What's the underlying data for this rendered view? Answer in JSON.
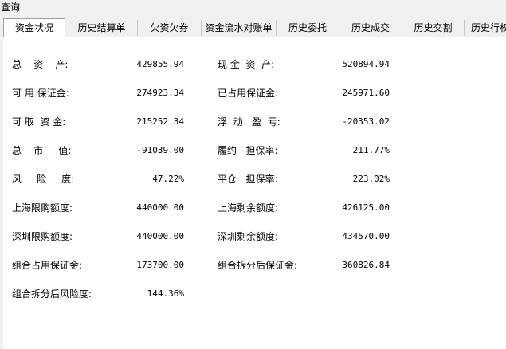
{
  "window": {
    "title": "查询"
  },
  "tabs": [
    {
      "label": "资金状况",
      "active": true
    },
    {
      "label": "历史结算单"
    },
    {
      "label": "欠资欠券"
    },
    {
      "label": "资金流水对账单"
    },
    {
      "label": "历史委托"
    },
    {
      "label": "历史成交"
    },
    {
      "label": "历史交割"
    },
    {
      "label": "历史行权"
    }
  ],
  "fields": {
    "total_assets": {
      "label": "总    资    产:",
      "value": "429855.94"
    },
    "cash_assets": {
      "label": "现 金  资  产:",
      "value": "520894.94"
    },
    "available_margin": {
      "label": "可 用 保证金:",
      "value": "274923.34"
    },
    "used_margin": {
      "label": "已占用保证金:",
      "value": "245971.60"
    },
    "withdrawable": {
      "label": "可 取  资 金:",
      "value": "215252.34"
    },
    "floating_pnl": {
      "label": "浮  动   盈  亏:",
      "value": "-20353.02"
    },
    "market_value": {
      "label": "总    市     值:",
      "value": "-91039.00"
    },
    "performance_ratio": {
      "label": "履约   担保率:",
      "value": "211.77%"
    },
    "risk_level": {
      "label": "风     险     度:",
      "value": "47.22%"
    },
    "closeout_ratio": {
      "label": "平仓   担保率:",
      "value": "223.02%"
    },
    "sh_limit": {
      "label": "上海限购额度:",
      "value": "440000.00"
    },
    "sh_remaining": {
      "label": "上海剩余额度:",
      "value": "426125.00"
    },
    "sz_limit": {
      "label": "深圳限购额度:",
      "value": "440000.00"
    },
    "sz_remaining": {
      "label": "深圳剩余额度:",
      "value": "434570.00"
    },
    "combo_used_margin": {
      "label": "组合占用保证金:",
      "value": "173700.00"
    },
    "combo_split_margin": {
      "label": "组合拆分后保证金:",
      "value": "360826.84"
    },
    "combo_split_risk": {
      "label": "组合拆分后风险度:",
      "value": "144.36%"
    }
  }
}
